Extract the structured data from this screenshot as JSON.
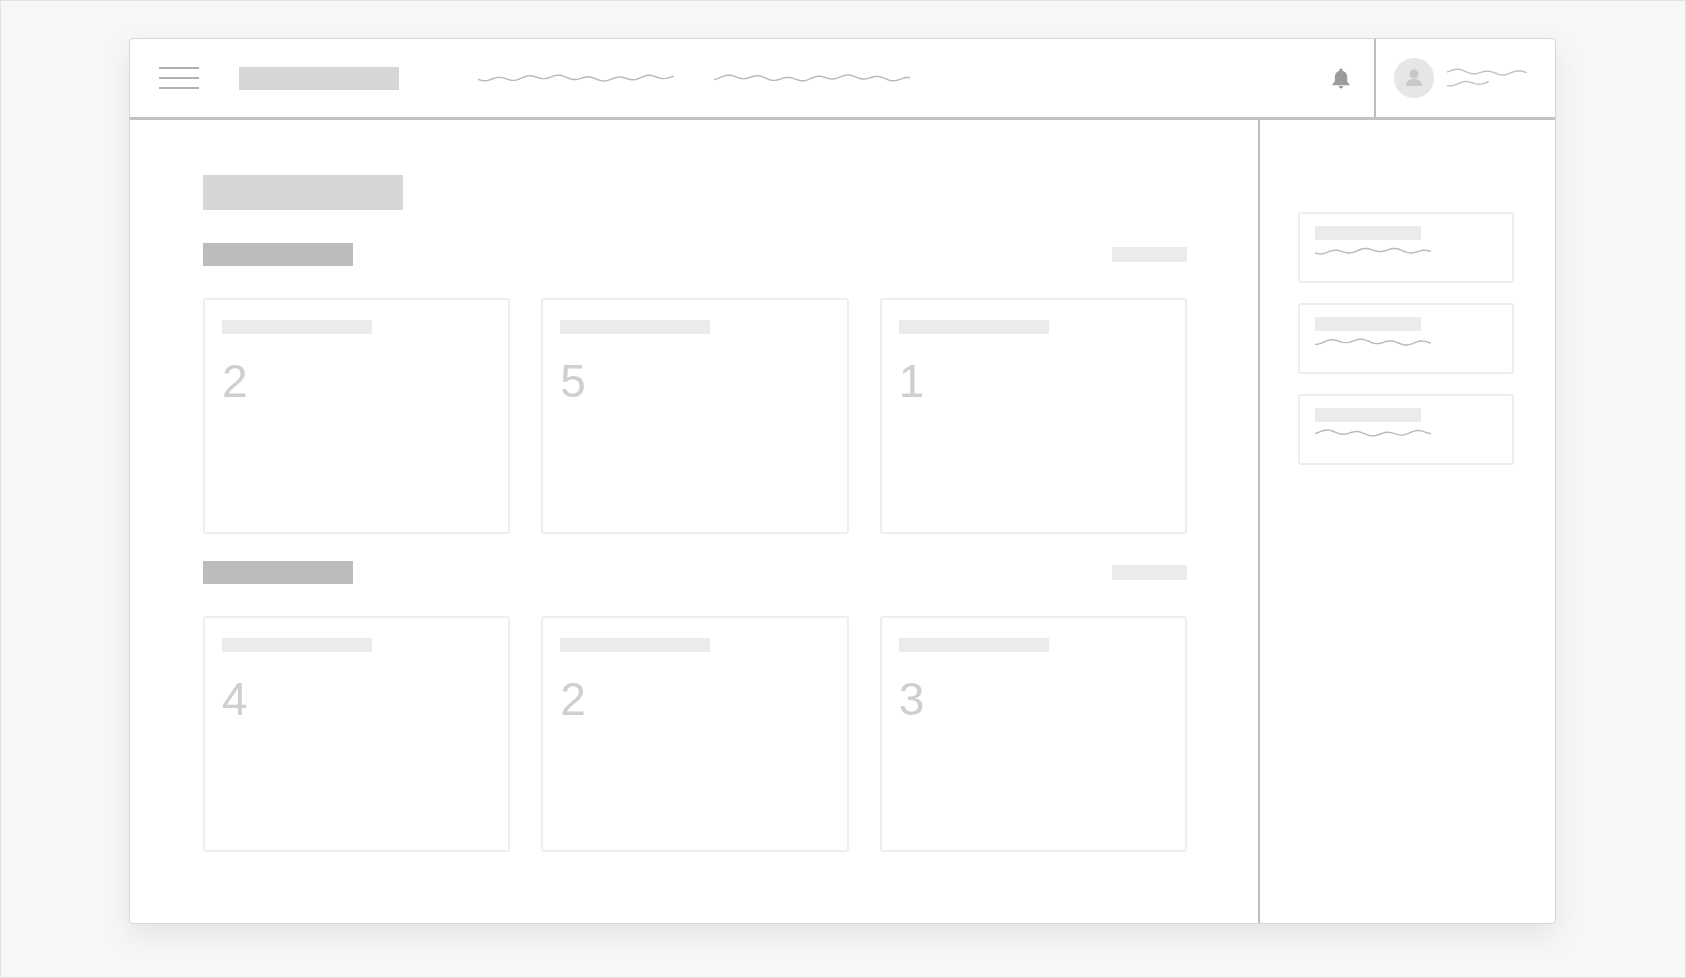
{
  "sections": [
    {
      "cards": [
        {
          "count": "2"
        },
        {
          "count": "5"
        },
        {
          "count": "1"
        }
      ]
    },
    {
      "cards": [
        {
          "count": "4"
        },
        {
          "count": "2"
        },
        {
          "count": "3"
        }
      ]
    }
  ]
}
